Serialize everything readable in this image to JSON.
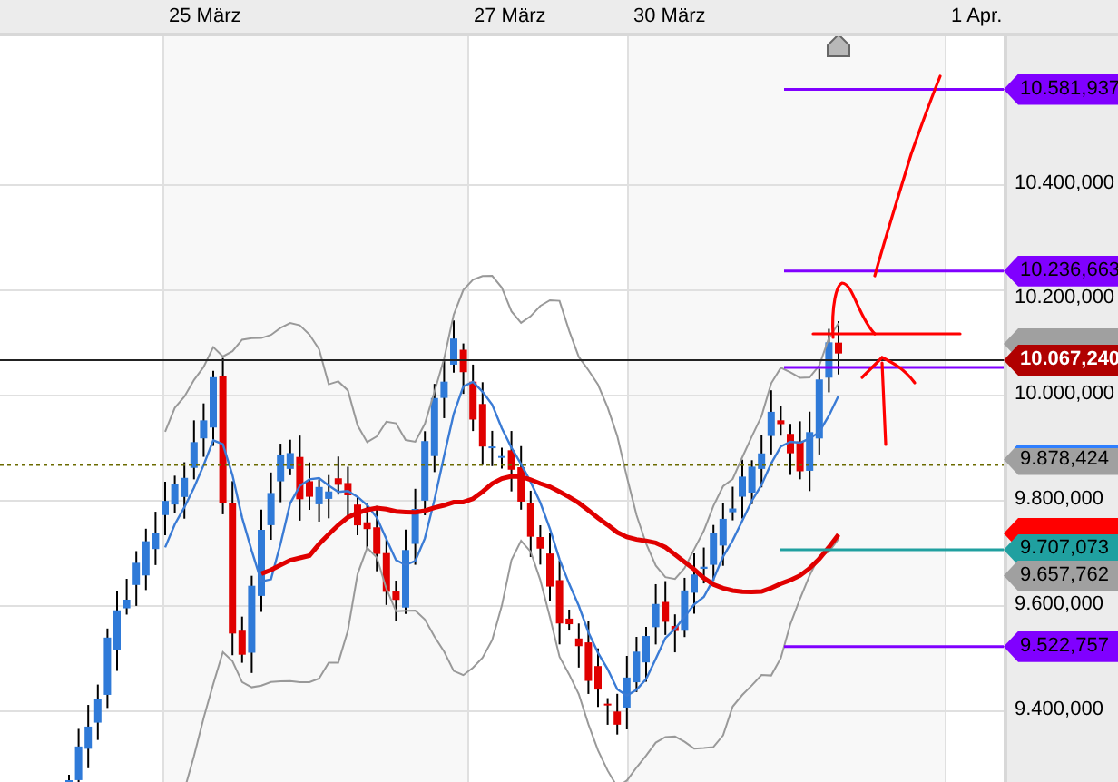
{
  "time_axis": {
    "labels": [
      "25 März",
      "27 März",
      "30 März",
      "1 Apr."
    ]
  },
  "price_axis": {
    "labels": [
      "10.400,000",
      "10.200,000",
      "10.000,000",
      "9.800,000",
      "9.600,000",
      "9.400,000"
    ]
  },
  "price_tags": [
    {
      "kind": "level",
      "text": "10.581,937",
      "color": "#8000ff"
    },
    {
      "kind": "level",
      "text": "10.236,663",
      "color": "#8000ff"
    },
    {
      "kind": "hidden",
      "color": "#a0a0a0"
    },
    {
      "kind": "current",
      "text": "10.067,240",
      "color": "#b00000"
    },
    {
      "kind": "level",
      "text": "9.878,424",
      "color": "#a0a0a0",
      "edge": {
        "color": "#2f7fff"
      }
    },
    {
      "kind": "hidden",
      "color": "#ff0000"
    },
    {
      "kind": "level",
      "text": "9.707,073",
      "color": "#20a0a0"
    },
    {
      "kind": "level",
      "text": "9.657,762",
      "color": "#a0a0a0"
    },
    {
      "kind": "level",
      "text": "9.522,757",
      "color": "#8000ff"
    }
  ]
}
